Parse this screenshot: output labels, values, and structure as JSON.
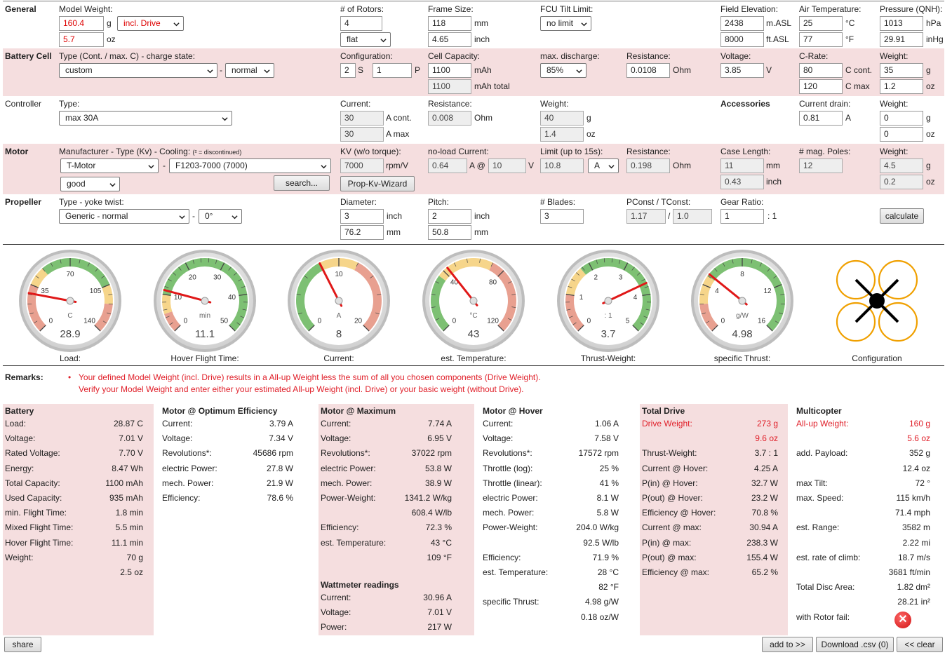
{
  "general": {
    "title": "General",
    "model_weight_label": "Model Weight:",
    "model_weight_g": "160.4",
    "unit_g": "g",
    "weight_mode": "incl. Drive",
    "model_weight_oz": "5.7",
    "unit_oz": "oz",
    "rotors_label": "# of Rotors:",
    "rotors": "4",
    "rotor_layout": "flat",
    "frame_label": "Frame Size:",
    "frame_mm": "118",
    "unit_mm": "mm",
    "frame_inch": "4.65",
    "unit_inch": "inch",
    "fcu_label": "FCU Tilt Limit:",
    "fcu": "no limit",
    "elev_label": "Field Elevation:",
    "elev_m": "2438",
    "unit_masl": "m.ASL",
    "elev_ft": "8000",
    "unit_ftasl": "ft.ASL",
    "air_label": "Air Temperature:",
    "air_c": "25",
    "unit_c": "°C",
    "air_f": "77",
    "unit_f": "°F",
    "press_label": "Pressure (QNH):",
    "press_hpa": "1013",
    "unit_hpa": "hPa",
    "press_inhg": "29.91",
    "unit_inhg": "inHg"
  },
  "battery": {
    "title": "Battery Cell",
    "type_label": "Type (Cont. / max. C) - charge state:",
    "type": "custom",
    "dash": "-",
    "charge_state": "normal",
    "config_label": "Configuration:",
    "s": "2",
    "s_unit": "S",
    "p": "1",
    "p_unit": "P",
    "capacity_label": "Cell Capacity:",
    "capacity": "1100",
    "cap_unit": "mAh",
    "capacity_total": "1100",
    "cap_total_unit": "mAh total",
    "discharge_label": "max. discharge:",
    "discharge": "85%",
    "res_label": "Resistance:",
    "resistance": "0.0108",
    "res_unit": "Ohm",
    "volt_label": "Voltage:",
    "voltage": "3.85",
    "volt_unit": "V",
    "crate_label": "C-Rate:",
    "c_cont": "80",
    "c_cont_unit": "C cont.",
    "c_max": "120",
    "c_max_unit": "C max",
    "weight_label": "Weight:",
    "weight_g": "35",
    "weight_oz": "1.2",
    "unit_g": "g",
    "unit_oz": "oz"
  },
  "controller": {
    "title": "Controller",
    "type_label": "Type:",
    "type": "max 30A",
    "current_label": "Current:",
    "cur_cont": "30",
    "cur_cont_unit": "A cont.",
    "cur_max": "30",
    "cur_max_unit": "A max",
    "res_label": "Resistance:",
    "resistance": "0.008",
    "res_unit": "Ohm",
    "weight_label": "Weight:",
    "weight_g": "40",
    "weight_oz": "1.4",
    "unit_g": "g",
    "unit_oz": "oz",
    "acc_title": "Accessories",
    "drain_label": "Current drain:",
    "drain": "0.81",
    "drain_unit": "A",
    "acc_weight_label": "Weight:",
    "acc_weight_g": "0",
    "acc_weight_oz": "0"
  },
  "motor": {
    "title": "Motor",
    "mfr_label": "Manufacturer - Type (Kv) - Cooling:",
    "mfr_note": "(² = discontinued)",
    "manufacturer": "T-Motor",
    "dash": "-",
    "model": "F1203-7000 (7000)",
    "cooling": "good",
    "search": "search...",
    "kv_label": "KV (w/o torque):",
    "kv": "7000",
    "kv_unit": "rpm/V",
    "wizard": "Prop-Kv-Wizard",
    "noload_label": "no-load Current:",
    "noload": "0.64",
    "noload_at": "A @",
    "noload_v": "10",
    "noload_v_unit": "V",
    "limit_label": "Limit (up to 15s):",
    "limit": "10.8",
    "limit_unit": "A",
    "res_label": "Resistance:",
    "resistance": "0.198",
    "res_unit": "Ohm",
    "case_label": "Case Length:",
    "case_mm": "11",
    "case_inch": "0.43",
    "unit_mm": "mm",
    "unit_inch": "inch",
    "poles_label": "# mag. Poles:",
    "poles": "12",
    "weight_label": "Weight:",
    "weight_g": "4.5",
    "weight_oz": "0.2",
    "unit_g": "g",
    "unit_oz": "oz"
  },
  "propeller": {
    "title": "Propeller",
    "type_label": "Type - yoke twist:",
    "type": "Generic - normal",
    "dash": "-",
    "twist": "0°",
    "dia_label": "Diameter:",
    "dia_inch": "3",
    "dia_mm": "76.2",
    "pitch_label": "Pitch:",
    "pitch_inch": "2",
    "pitch_mm": "50.8",
    "unit_inch": "inch",
    "unit_mm": "mm",
    "blades_label": "# Blades:",
    "blades": "3",
    "pconst_label": "PConst / TConst:",
    "pconst": "1.17",
    "slash": "/",
    "tconst": "1.0",
    "gear_label": "Gear Ratio:",
    "gear": "1",
    "gear_unit": ": 1",
    "calculate": "calculate"
  },
  "gauges": [
    {
      "caption": "Load:",
      "unit": "C",
      "value": "28.9",
      "ticks": [
        "0",
        "35",
        "70",
        "105",
        "140"
      ],
      "frac": 0.206
    },
    {
      "caption": "Hover Flight Time:",
      "unit": "min",
      "value": "11.1",
      "ticks": [
        "0",
        "10",
        "20",
        "30",
        "40",
        "50"
      ],
      "frac": 0.222
    },
    {
      "caption": "Current:",
      "unit": "A",
      "value": "8",
      "ticks": [
        "0",
        "10",
        "20"
      ],
      "frac": 0.4
    },
    {
      "caption": "est. Temperature:",
      "unit": "°C",
      "value": "43",
      "ticks": [
        "0",
        "40",
        "80",
        "120"
      ],
      "frac": 0.358
    },
    {
      "caption": "Thrust-Weight:",
      "unit": ": 1",
      "value": "3.7",
      "ticks": [
        "0",
        "1",
        "2",
        "3",
        "4",
        "5"
      ],
      "frac": 0.74
    },
    {
      "caption": "specific Thrust:",
      "unit": "g/W",
      "value": "4.98",
      "ticks": [
        "0",
        "4",
        "8",
        "12",
        "16"
      ],
      "frac": 0.311
    }
  ],
  "configuration_caption": "Configuration",
  "remarks": {
    "label": "Remarks:",
    "line1": "Your defined Model Weight (incl. Drive) results in a All-up Weight less the sum of all you chosen components (Drive Weight).",
    "line2": "Verify your Model Weight and enter either your estimated All-up Weight (incl. Drive) or your basic weight (without Drive)."
  },
  "results": {
    "battery": {
      "title": "Battery",
      "rows": [
        [
          "Load:",
          "28.87 C"
        ],
        [
          "Voltage:",
          "7.01 V"
        ],
        [
          "Rated Voltage:",
          "7.70 V"
        ],
        [
          "Energy:",
          "8.47 Wh"
        ],
        [
          "Total Capacity:",
          "1100 mAh"
        ],
        [
          "Used Capacity:",
          "935 mAh"
        ],
        [
          "min. Flight Time:",
          "1.8 min"
        ],
        [
          "Mixed Flight Time:",
          "5.5 min"
        ],
        [
          "Hover Flight Time:",
          "11.1 min"
        ],
        [
          "Weight:",
          "70 g"
        ],
        [
          "",
          "2.5 oz"
        ]
      ]
    },
    "optimum": {
      "title": "Motor @ Optimum Efficiency",
      "rows": [
        [
          "Current:",
          "3.79 A"
        ],
        [
          "Voltage:",
          "7.34 V"
        ],
        [
          "Revolutions*:",
          "45686 rpm"
        ],
        [
          "electric Power:",
          "27.8 W"
        ],
        [
          "mech. Power:",
          "21.9 W"
        ],
        [
          "Efficiency:",
          "78.6 %"
        ]
      ]
    },
    "maximum": {
      "title": "Motor @ Maximum",
      "rows": [
        [
          "Current:",
          "7.74 A"
        ],
        [
          "Voltage:",
          "6.95 V"
        ],
        [
          "Revolutions*:",
          "37022 rpm"
        ],
        [
          "electric Power:",
          "53.8 W"
        ],
        [
          "mech. Power:",
          "38.9 W"
        ],
        [
          "Power-Weight:",
          "1341.2 W/kg"
        ],
        [
          "",
          "608.4 W/lb"
        ],
        [
          "Efficiency:",
          "72.3 %"
        ],
        [
          "est. Temperature:",
          "43 °C"
        ],
        [
          "",
          "109 °F"
        ]
      ]
    },
    "wattmeter": {
      "title": "Wattmeter readings",
      "rows": [
        [
          "Current:",
          "30.96 A"
        ],
        [
          "Voltage:",
          "7.01 V"
        ],
        [
          "Power:",
          "217 W"
        ]
      ]
    },
    "hover": {
      "title": "Motor @ Hover",
      "rows": [
        [
          "Current:",
          "1.06 A"
        ],
        [
          "Voltage:",
          "7.58 V"
        ],
        [
          "Revolutions*:",
          "17572 rpm"
        ],
        [
          "Throttle (log):",
          "25 %"
        ],
        [
          "Throttle (linear):",
          "41 %"
        ],
        [
          "electric Power:",
          "8.1 W"
        ],
        [
          "mech. Power:",
          "5.8 W"
        ],
        [
          "Power-Weight:",
          "204.0 W/kg"
        ],
        [
          "",
          "92.5 W/lb"
        ],
        [
          "Efficiency:",
          "71.9 %"
        ],
        [
          "est. Temperature:",
          "28 °C"
        ],
        [
          "",
          "82 °F"
        ],
        [
          "specific Thrust:",
          "4.98 g/W"
        ],
        [
          "",
          "0.18 oz/W"
        ]
      ]
    },
    "total": {
      "title": "Total Drive",
      "rows": [
        [
          "Drive Weight:",
          "273 g"
        ],
        [
          "",
          "9.6 oz"
        ],
        [
          "Thrust-Weight:",
          "3.7 : 1"
        ],
        [
          "Current @ Hover:",
          "4.25 A"
        ],
        [
          "P(in) @ Hover:",
          "32.7 W"
        ],
        [
          "P(out) @ Hover:",
          "23.2 W"
        ],
        [
          "Efficiency @ Hover:",
          "70.8 %"
        ],
        [
          "Current @ max:",
          "30.94 A"
        ],
        [
          "P(in) @ max:",
          "238.3 W"
        ],
        [
          "P(out) @ max:",
          "155.4 W"
        ],
        [
          "Efficiency @ max:",
          "65.2 %"
        ]
      ]
    },
    "multicopter": {
      "title": "Multicopter",
      "rows": [
        [
          "All-up Weight:",
          "160 g"
        ],
        [
          "",
          "5.6 oz"
        ],
        [
          "add. Payload:",
          "352 g"
        ],
        [
          "",
          "12.4 oz"
        ],
        [
          "max Tilt:",
          "72 °"
        ],
        [
          "max. Speed:",
          "115 km/h"
        ],
        [
          "",
          "71.4 mph"
        ],
        [
          "est. Range:",
          "3582 m"
        ],
        [
          "",
          "2.22 mi"
        ],
        [
          "est. rate of climb:",
          "18.7 m/s"
        ],
        [
          "",
          "3681 ft/min"
        ],
        [
          "Total Disc Area:",
          "1.82 dm²"
        ],
        [
          "",
          "28.21 in²"
        ],
        [
          "with Rotor fail:",
          ""
        ]
      ]
    }
  },
  "footer": {
    "share": "share",
    "add": "add to >>",
    "download": "Download .csv (0)",
    "clear": "<< clear"
  }
}
